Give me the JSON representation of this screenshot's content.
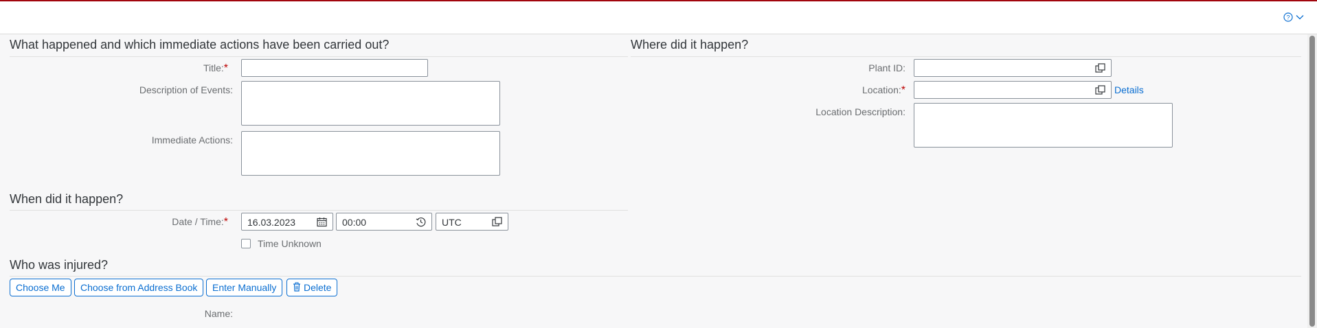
{
  "header": {
    "help_icon": "help-icon",
    "expand_icon": "chevron-down-icon"
  },
  "what": {
    "title": "What happened and which immediate actions have been carried out?",
    "title_label": "Title:",
    "title_value": "",
    "description_label": "Description of Events:",
    "description_value": "",
    "actions_label": "Immediate Actions:",
    "actions_value": ""
  },
  "where": {
    "title": "Where did it happen?",
    "plant_label": "Plant ID:",
    "plant_value": "",
    "location_label": "Location:",
    "location_value": "",
    "details_link": "Details",
    "location_desc_label": "Location Description:",
    "location_desc_value": ""
  },
  "when": {
    "title": "When did it happen?",
    "datetime_label": "Date / Time:",
    "date_value": "16.03.2023",
    "time_value": "00:00",
    "timezone_value": "UTC",
    "time_unknown_label": "Time Unknown",
    "time_unknown_checked": false
  },
  "who": {
    "title": "Who was injured?",
    "choose_me": "Choose Me",
    "choose_address_book": "Choose from Address Book",
    "enter_manually": "Enter Manually",
    "delete": "Delete",
    "name_label": "Name:"
  },
  "colors": {
    "accent": "#0a6ed1",
    "required": "#bb0000",
    "shell_border": "#a1050d"
  }
}
